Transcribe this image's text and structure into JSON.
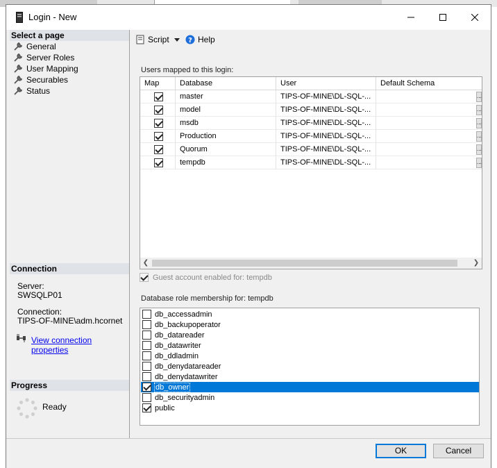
{
  "window": {
    "title": "Login - New"
  },
  "left_pane": {
    "select_page_header": "Select a page",
    "pages": [
      {
        "label": "General"
      },
      {
        "label": "Server Roles"
      },
      {
        "label": "User Mapping"
      },
      {
        "label": "Securables"
      },
      {
        "label": "Status"
      }
    ],
    "connection_header": "Connection",
    "server_label": "Server:",
    "server_value": "SWSQLP01",
    "connection_label": "Connection:",
    "connection_value": "TIPS-OF-MINE\\adm.hcornet",
    "view_props_link": "View connection properties",
    "progress_header": "Progress",
    "progress_status": "Ready"
  },
  "toolbar": {
    "script_label": "Script",
    "help_label": "Help"
  },
  "users_grid": {
    "section_label": "Users mapped to this login:",
    "columns": [
      "Map",
      "Database",
      "User",
      "Default Schema"
    ],
    "rows": [
      {
        "map": true,
        "database": "master",
        "user": "TIPS-OF-MINE\\DL-SQL-...",
        "schema": ""
      },
      {
        "map": true,
        "database": "model",
        "user": "TIPS-OF-MINE\\DL-SQL-...",
        "schema": ""
      },
      {
        "map": true,
        "database": "msdb",
        "user": "TIPS-OF-MINE\\DL-SQL-...",
        "schema": ""
      },
      {
        "map": true,
        "database": "Production",
        "user": "TIPS-OF-MINE\\DL-SQL-...",
        "schema": ""
      },
      {
        "map": true,
        "database": "Quorum",
        "user": "TIPS-OF-MINE\\DL-SQL-...",
        "schema": ""
      },
      {
        "map": true,
        "database": "tempdb",
        "user": "TIPS-OF-MINE\\DL-SQL-...",
        "schema": ""
      }
    ],
    "ellipsis_label": "..."
  },
  "guest": {
    "label": "Guest account enabled for: tempdb",
    "checked": true
  },
  "roles": {
    "section_label": "Database role membership for: tempdb",
    "items": [
      {
        "label": "db_accessadmin",
        "checked": false
      },
      {
        "label": "db_backupoperator",
        "checked": false
      },
      {
        "label": "db_datareader",
        "checked": false
      },
      {
        "label": "db_datawriter",
        "checked": false
      },
      {
        "label": "db_ddladmin",
        "checked": false
      },
      {
        "label": "db_denydatareader",
        "checked": false
      },
      {
        "label": "db_denydatawriter",
        "checked": false
      },
      {
        "label": "db_owner",
        "checked": true,
        "selected": true
      },
      {
        "label": "db_securityadmin",
        "checked": false
      },
      {
        "label": "public",
        "checked": true
      }
    ]
  },
  "buttons": {
    "ok": "OK",
    "cancel": "Cancel"
  },
  "colors": {
    "accent": "#0078d7",
    "link": "#0000ee",
    "header_bg": "#dfe3e8"
  }
}
